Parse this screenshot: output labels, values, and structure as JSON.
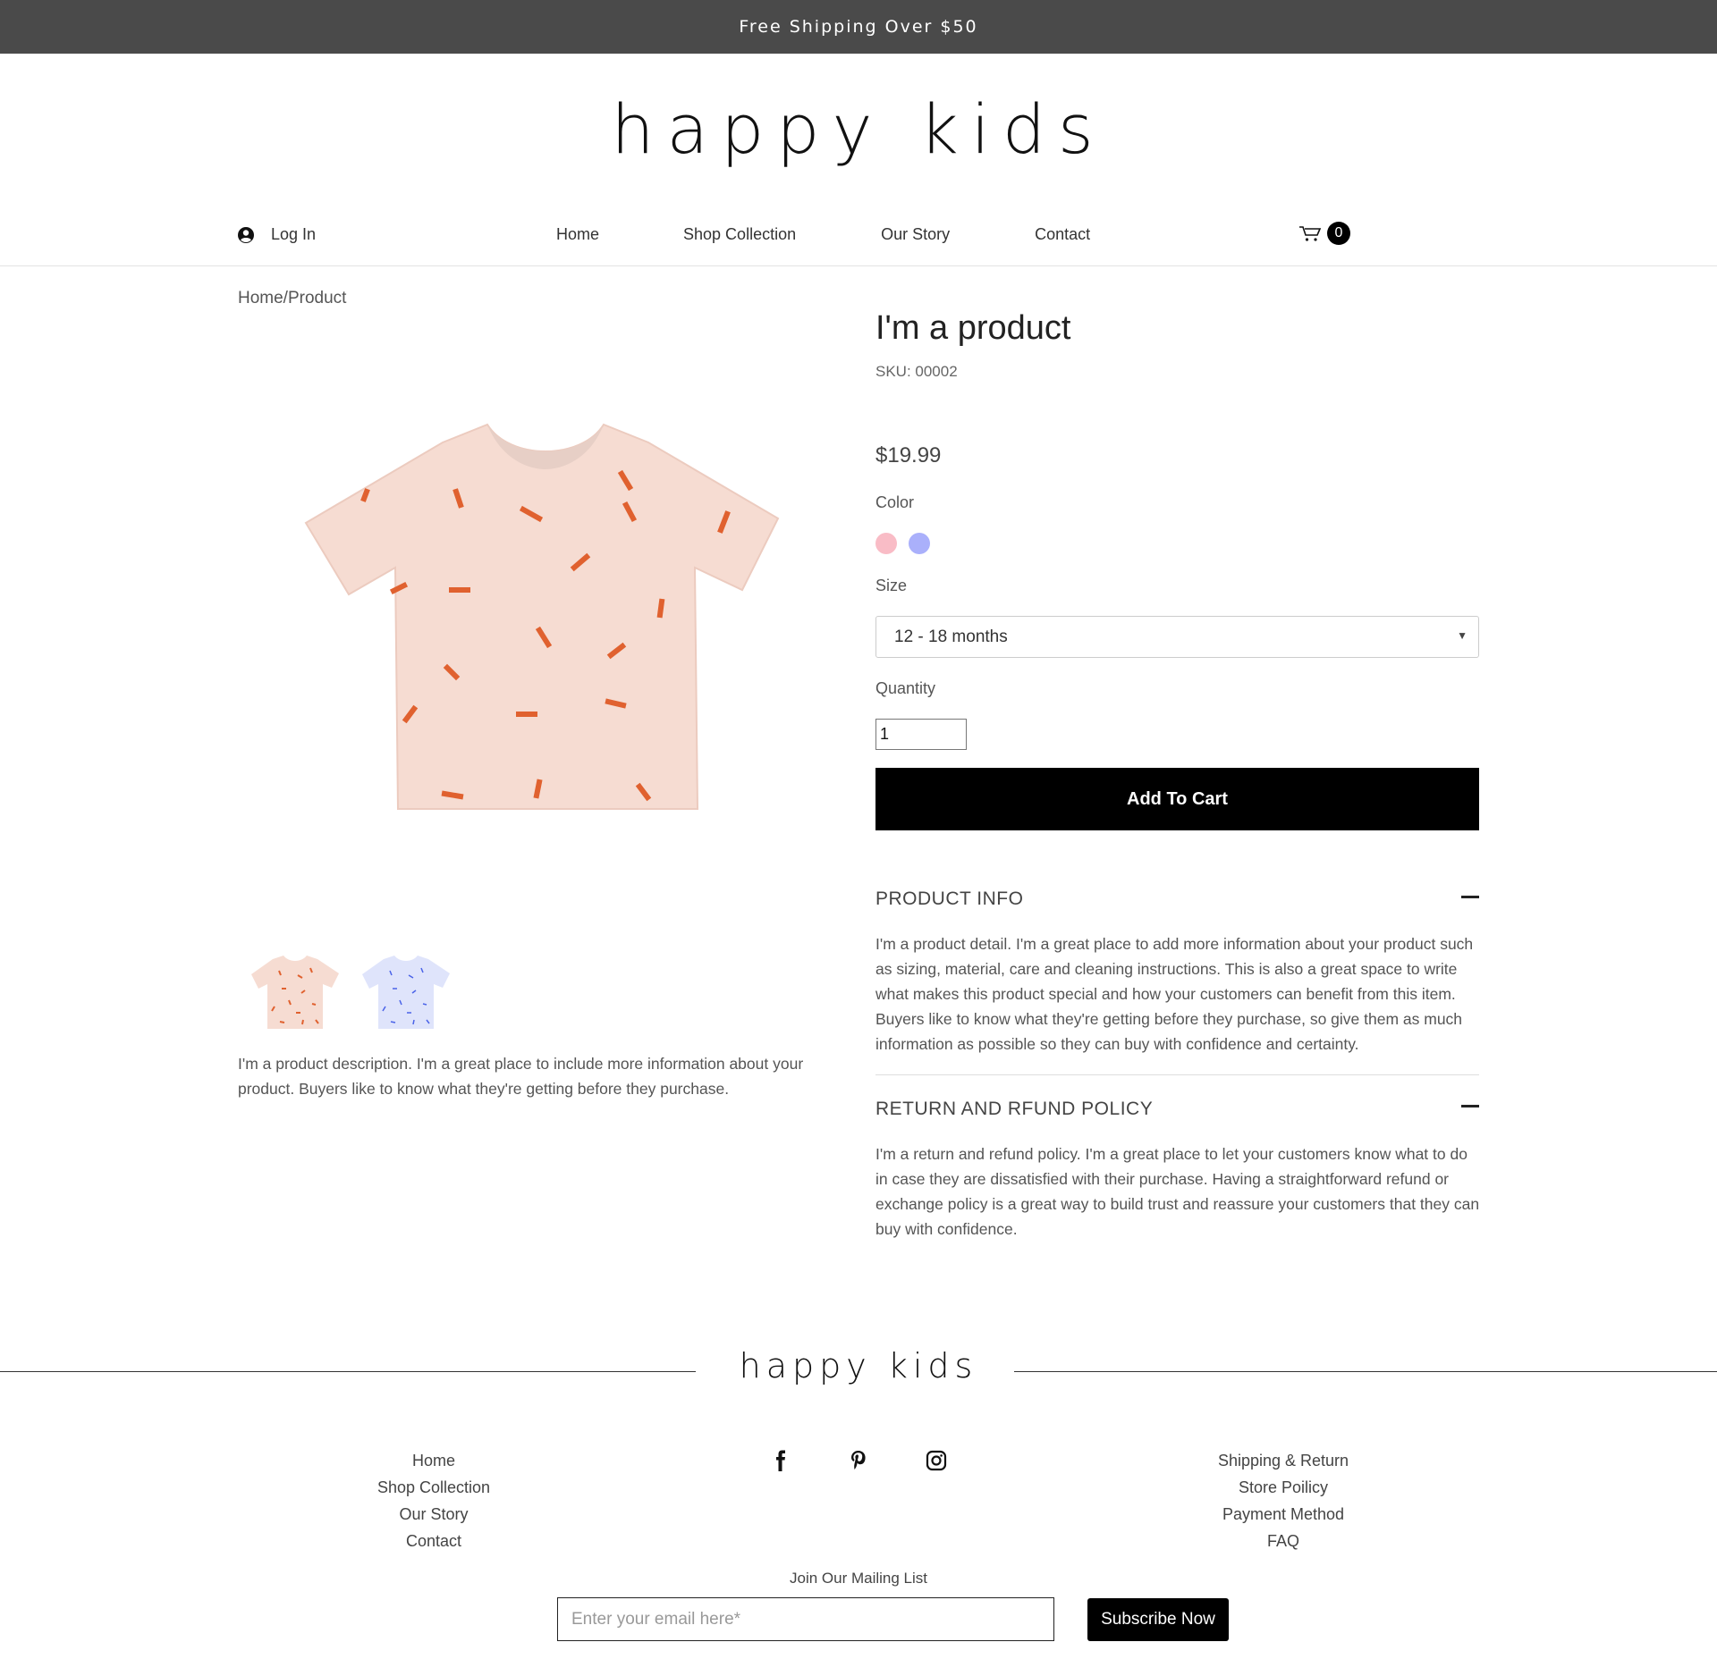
{
  "announcement": "Free Shipping Over $50",
  "brand": "happy kids",
  "nav": {
    "login_label": "Log In",
    "user_icon": "user-circle-icon",
    "menu": [
      "Home",
      "Shop Collection",
      "Our Story",
      "Contact"
    ],
    "cart_icon": "cart-icon",
    "cart_count": "0"
  },
  "breadcrumb": "Home/Product",
  "product": {
    "title": "I'm a product",
    "sku": "SKU: 00002",
    "price": "$19.99",
    "color_label": "Color",
    "colors": [
      "#f9bcc6",
      "#aab0fb"
    ],
    "size_label": "Size",
    "size_value": "12 - 18 months",
    "quantity_label": "Quantity",
    "quantity_value": "1",
    "add_to_cart": "Add To Cart",
    "description": "I'm a product description. I'm a great place to include more information about your product. Buyers like to know what they're getting before they purchase."
  },
  "sections": {
    "info_title": "PRODUCT INFO",
    "info_text": "I'm a product detail. I'm a great place to add more information about your product such as sizing, material, care and cleaning instructions. This is also a great space to write what makes this product special and how your customers can benefit from this item. Buyers like to know what they're getting before they purchase, so give them as much information as possible so they can buy with confidence and certainty.",
    "policy_title": "RETURN AND RFUND POLICY",
    "policy_text": "I'm a return and refund policy. I'm a great place to let your customers know what to do in case they are dissatisfied with their purchase. Having a straightforward refund or exchange policy is a great way to build trust and reassure your customers that they can buy with confidence."
  },
  "footer": {
    "brand": "happy kids",
    "left_links": [
      "Home",
      "Shop Collection",
      "Our Story",
      "Contact"
    ],
    "right_links": [
      "Shipping & Return",
      "Store Poilicy",
      "Payment Method",
      "FAQ"
    ],
    "social_icons": [
      "facebook-icon",
      "pinterest-icon",
      "instagram-icon"
    ],
    "mailing_label": "Join Our Mailing List",
    "email_placeholder": "Enter your email here*",
    "subscribe": "Subscribe Now"
  },
  "colors": {
    "topbar": "#4a4a4a",
    "shirt_peach": "#f6dcd2",
    "shirt_blue": "#dfe4fb",
    "confetti_orange": "#e0612f",
    "confetti_blue": "#4a63e8"
  }
}
